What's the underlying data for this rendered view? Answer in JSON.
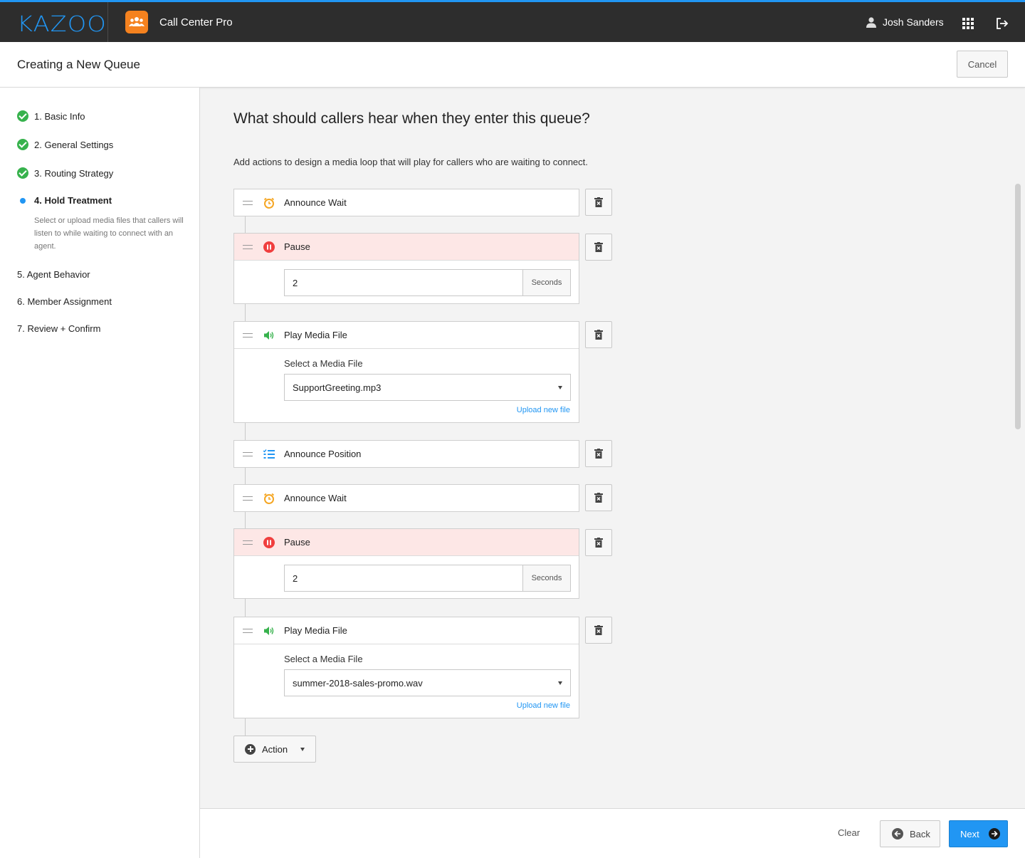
{
  "topbar": {
    "logo": "KAZOO",
    "app_name": "Call Center Pro",
    "user_name": "Josh Sanders"
  },
  "header": {
    "title": "Creating a New Queue",
    "cancel_label": "Cancel"
  },
  "sidebar": {
    "steps": [
      {
        "label": "1. Basic Info",
        "status": "complete"
      },
      {
        "label": "2. General Settings",
        "status": "complete"
      },
      {
        "label": "3. Routing Strategy",
        "status": "complete"
      },
      {
        "label": "4. Hold Treatment",
        "status": "active"
      },
      {
        "label": "5. Agent Behavior",
        "status": "pending"
      },
      {
        "label": "6. Member Assignment",
        "status": "pending"
      },
      {
        "label": "7. Review + Confirm",
        "status": "pending"
      }
    ],
    "active_description": "Select or upload media files that callers will listen to while waiting to connect with an agent."
  },
  "main": {
    "title": "What should callers hear when they enter this queue?",
    "description": "Add actions to design a media loop that will play for callers who are waiting to connect.",
    "actions": [
      {
        "type": "announce-wait",
        "label": "Announce Wait",
        "icon": "alarm-clock-icon"
      },
      {
        "type": "pause",
        "label": "Pause",
        "icon": "pause-icon",
        "value": "2",
        "unit": "Seconds"
      },
      {
        "type": "play-media",
        "label": "Play Media File",
        "icon": "speaker-icon",
        "select_label": "Select a Media File",
        "selected": "SupportGreeting.mp3",
        "upload_label": "Upload new file"
      },
      {
        "type": "announce-position",
        "label": "Announce Position",
        "icon": "list-icon"
      },
      {
        "type": "announce-wait",
        "label": "Announce Wait",
        "icon": "alarm-clock-icon"
      },
      {
        "type": "pause",
        "label": "Pause",
        "icon": "pause-icon",
        "value": "2",
        "unit": "Seconds"
      },
      {
        "type": "play-media",
        "label": "Play Media File",
        "icon": "speaker-icon",
        "select_label": "Select a Media File",
        "selected": "summer-2018-sales-promo.wav",
        "upload_label": "Upload new file"
      }
    ],
    "add_action_label": "Action"
  },
  "footer": {
    "clear_label": "Clear",
    "back_label": "Back",
    "next_label": "Next"
  },
  "colors": {
    "accent": "#2196f3",
    "complete": "#37b24d",
    "pause": "#f03e3e",
    "pause_bg": "#fde7e6",
    "wait": "#f5a623",
    "media": "#37b24d",
    "app_icon": "#f5821f"
  }
}
